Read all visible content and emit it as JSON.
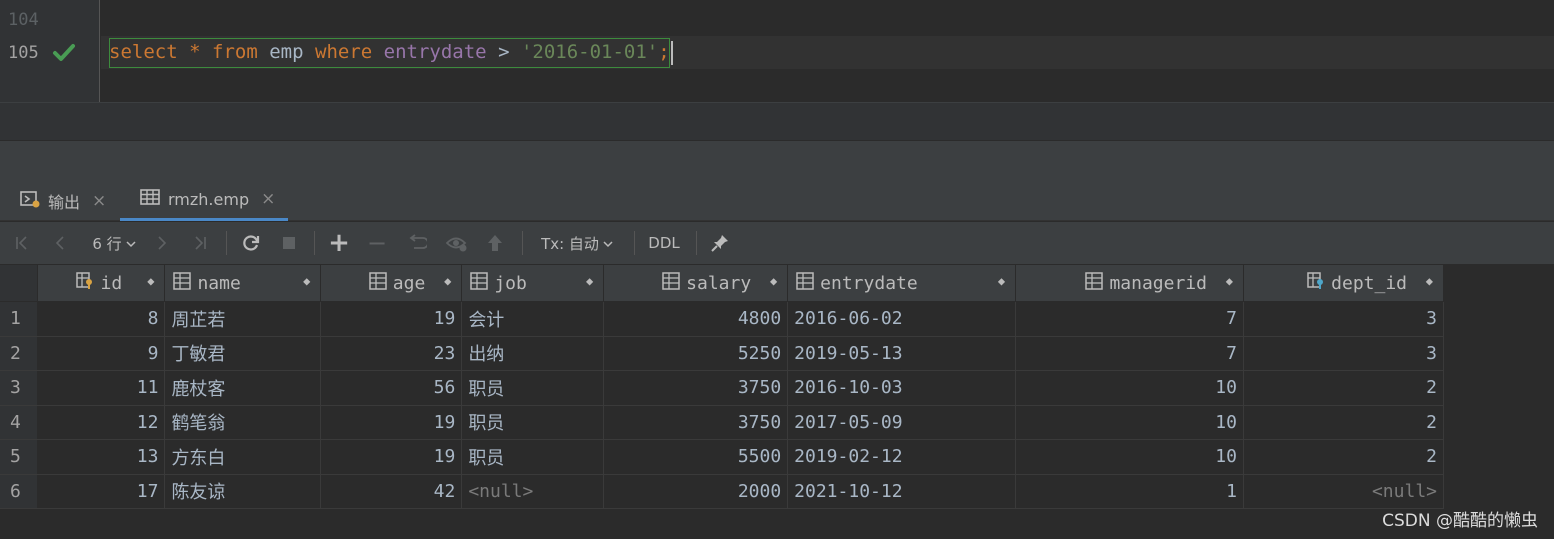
{
  "editor": {
    "lines": [
      {
        "number": "104",
        "status": ""
      },
      {
        "number": "105",
        "status": "check-icon"
      }
    ],
    "code": {
      "kw_select": "select",
      "star": "*",
      "kw_from": "from",
      "table": "emp",
      "kw_where": "where",
      "column": "entrydate",
      "operator": ">",
      "literal": "'2016-01-01'",
      "terminator": ";"
    }
  },
  "tabs": [
    {
      "label": "输出",
      "icon": "console-icon",
      "close": "×"
    },
    {
      "label": "rmzh.emp",
      "icon": "table-icon",
      "close": "×",
      "active": true
    }
  ],
  "toolbar": {
    "first_icon": "first-page-icon",
    "prev_icon": "prev-page-icon",
    "rows_label": "6 行",
    "next_icon": "next-page-icon",
    "last_icon": "last-page-icon",
    "refresh_icon": "refresh-icon",
    "stop_icon": "stop-icon",
    "add_label": "+",
    "remove_label": "−",
    "revert_icon": "revert-icon",
    "preview_icon": "preview-icon",
    "submit_icon": "submit-icon",
    "tx_label": "Tx: 自动",
    "ddl_label": "DDL",
    "pin_icon": "pin-icon"
  },
  "grid": {
    "columns": [
      {
        "key": "id",
        "label": "id",
        "icon": "key-column-icon",
        "align": "right"
      },
      {
        "key": "name",
        "label": "name",
        "icon": "column-icon",
        "align": "left"
      },
      {
        "key": "age",
        "label": "age",
        "icon": "column-icon",
        "align": "right"
      },
      {
        "key": "job",
        "label": "job",
        "icon": "column-icon",
        "align": "left"
      },
      {
        "key": "salary",
        "label": "salary",
        "icon": "column-icon",
        "align": "right"
      },
      {
        "key": "entrydate",
        "label": "entrydate",
        "icon": "column-icon",
        "align": "left"
      },
      {
        "key": "managerid",
        "label": "managerid",
        "icon": "column-icon",
        "align": "right"
      },
      {
        "key": "dept_id",
        "label": "dept_id",
        "icon": "foreign-key-column-icon",
        "align": "right"
      }
    ],
    "rows": [
      {
        "rn": "1",
        "id": "8",
        "name": "周芷若",
        "age": "19",
        "job": "会计",
        "salary": "4800",
        "entrydate": "2016-06-02",
        "managerid": "7",
        "dept_id": "3"
      },
      {
        "rn": "2",
        "id": "9",
        "name": "丁敏君",
        "age": "23",
        "job": "出纳",
        "salary": "5250",
        "entrydate": "2019-05-13",
        "managerid": "7",
        "dept_id": "3"
      },
      {
        "rn": "3",
        "id": "11",
        "name": "鹿杖客",
        "age": "56",
        "job": "职员",
        "salary": "3750",
        "entrydate": "2016-10-03",
        "managerid": "10",
        "dept_id": "2"
      },
      {
        "rn": "4",
        "id": "12",
        "name": "鹤笔翁",
        "age": "19",
        "job": "职员",
        "salary": "3750",
        "entrydate": "2017-05-09",
        "managerid": "10",
        "dept_id": "2"
      },
      {
        "rn": "5",
        "id": "13",
        "name": "方东白",
        "age": "19",
        "job": "职员",
        "salary": "5500",
        "entrydate": "2019-02-12",
        "managerid": "10",
        "dept_id": "2"
      },
      {
        "rn": "6",
        "id": "17",
        "name": "陈友谅",
        "age": "42",
        "job": "<null>",
        "salary": "2000",
        "entrydate": "2021-10-12",
        "managerid": "1",
        "dept_id": "<null>"
      }
    ]
  },
  "watermark": "CSDN @酷酷的懒虫",
  "colors": {
    "keyword": "#cc7832",
    "column": "#9876aa",
    "string": "#6a8759",
    "ok_check": "#499c54",
    "tab_underline": "#4a88c7"
  }
}
